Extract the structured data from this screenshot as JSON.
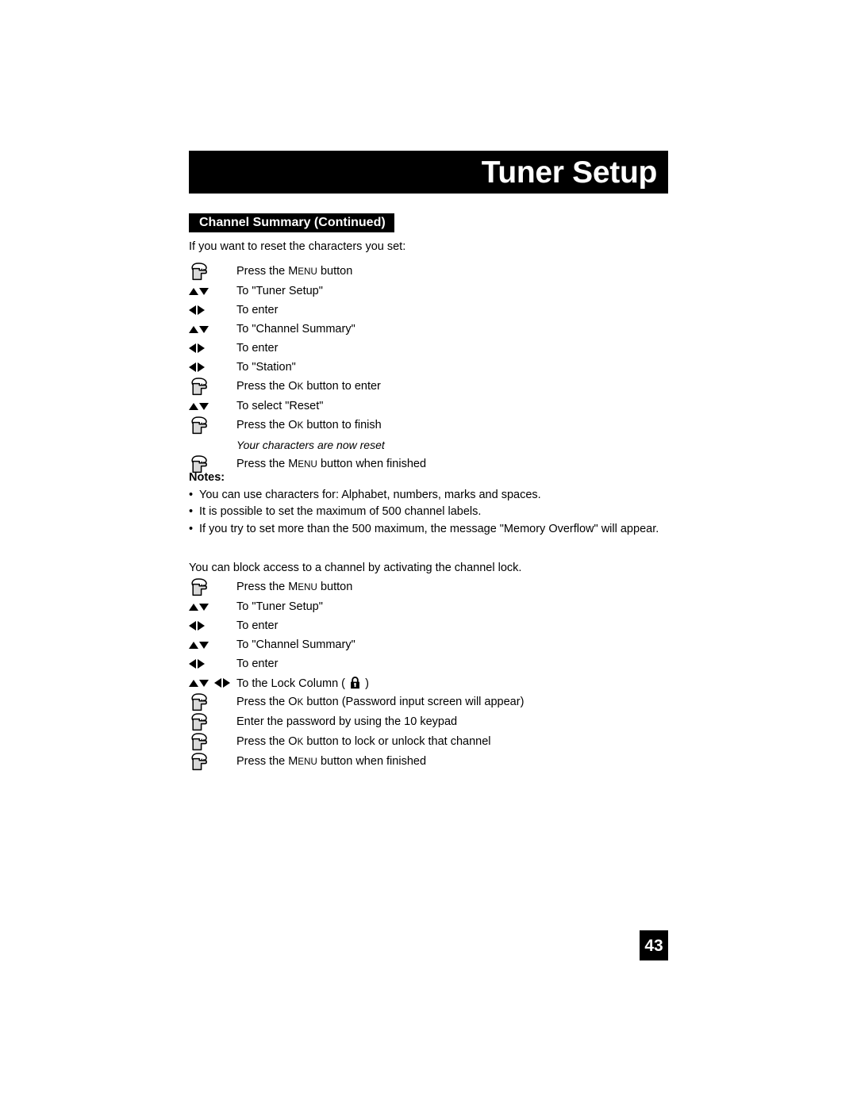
{
  "header": {
    "title": "Tuner Setup",
    "section_banner": "Channel Summary (Continued)"
  },
  "reset_section": {
    "lead": "If you want to reset the characters you set:",
    "steps": [
      {
        "marker": "press-hand",
        "text_prefix": "Press the ",
        "key": "Menu",
        "text_suffix": " button"
      },
      {
        "marker": "up-down",
        "text": "To \"Tuner Setup\""
      },
      {
        "marker": "left-right",
        "text": "To enter"
      },
      {
        "marker": "up-down",
        "text": "To \"Channel Summary\""
      },
      {
        "marker": "left-right",
        "text": "To enter"
      },
      {
        "marker": "left-right",
        "text": "To \"Station\""
      },
      {
        "marker": "press-hand",
        "text_prefix": "Press the ",
        "key": "Ok",
        "text_suffix": " button to enter"
      },
      {
        "marker": "up-down",
        "text": "To select \"Reset\""
      },
      {
        "marker": "press-hand",
        "text_prefix": "Press the ",
        "key": "Ok",
        "text_suffix": " button to finish"
      },
      {
        "marker": "none",
        "text": "Your characters are now reset",
        "italic": true
      },
      {
        "marker": "press-hand",
        "text_prefix": "Press the ",
        "key": "Menu",
        "text_suffix": " button when finished"
      }
    ]
  },
  "notes": {
    "title": "Notes:",
    "bullet": "•",
    "items": [
      "You can use characters for: Alphabet, numbers, marks and spaces.",
      "It is possible to set the maximum of 500 channel labels.",
      "If you try to set more than the 500 maximum, the message \"Memory Overflow\" will appear."
    ]
  },
  "lock_section": {
    "lead": "You can block access to a channel by activating the channel lock.",
    "steps": [
      {
        "marker": "press-hand",
        "text_prefix": "Press the ",
        "key": "Menu",
        "text_suffix": " button"
      },
      {
        "marker": "up-down",
        "text": "To \"Tuner Setup\""
      },
      {
        "marker": "left-right",
        "text": "To enter"
      },
      {
        "marker": "up-down",
        "text": "To \"Channel Summary\""
      },
      {
        "marker": "left-right",
        "text": "To enter"
      },
      {
        "marker": "quad",
        "text_prefix": "To the Lock Column ( ",
        "lock_icon": true,
        "text_suffix": " )"
      },
      {
        "marker": "press-hand",
        "text_prefix": "Press the ",
        "key": "Ok",
        "text_suffix": " button (Password input screen will appear)"
      },
      {
        "marker": "press-hand",
        "text": "Enter the password by using the 10 keypad"
      },
      {
        "marker": "press-hand",
        "text_prefix": "Press the ",
        "key": "Ok",
        "text_suffix": " button to lock or unlock that channel"
      },
      {
        "marker": "press-hand",
        "text_prefix": "Press the ",
        "key": "Menu",
        "text_suffix": " button when finished"
      }
    ]
  },
  "footer": {
    "page_number": "43"
  },
  "colors": {
    "ink": "#000000",
    "paper": "#ffffff",
    "banner_bg": "#000000",
    "banner_text": "#ffffff",
    "hand_fill": "#d9d9d9"
  }
}
